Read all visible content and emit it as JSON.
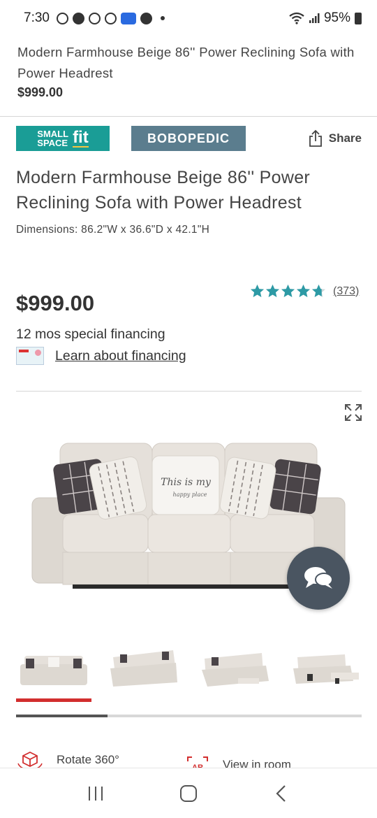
{
  "status_bar": {
    "time": "7:30",
    "battery": "95%"
  },
  "header": {
    "title": "Modern Farmhouse Beige 86'' Power Reclining Sofa with Power Headrest",
    "price": "$999.00"
  },
  "brands": {
    "small_space_line1": "SMALL",
    "small_space_line2": "SPACE",
    "small_space_fit": "fit",
    "bobopedic": "BOBOPEDIC",
    "share_label": "Share"
  },
  "product": {
    "title": "Modern Farmhouse Beige 86'' Power Reclining Sofa with Power Headrest",
    "dimensions": "Dimensions: 86.2\"W x 36.6\"D x 42.1\"H",
    "price": "$999.00",
    "rating": 4.7,
    "review_count": "(373)",
    "financing_text": "12 mos special financing",
    "financing_link": "Learn about financing"
  },
  "pillow_text": {
    "line1": "This is my",
    "line2": "happy place"
  },
  "gallery": {
    "thumbnails": [
      {
        "name": "front view"
      },
      {
        "name": "angled view"
      },
      {
        "name": "reclined view"
      },
      {
        "name": "side reclined view"
      }
    ],
    "selected_index": 0,
    "scroll_fraction": 0.265
  },
  "actions": {
    "rotate_label": "Rotate 360°",
    "ar_badge": "AR",
    "view_room_label": "View in room"
  },
  "colors": {
    "accent_red": "#d22e2e",
    "teal": "#1a9d96",
    "star": "#2d9aa5",
    "chat_fab": "#4a5561"
  }
}
